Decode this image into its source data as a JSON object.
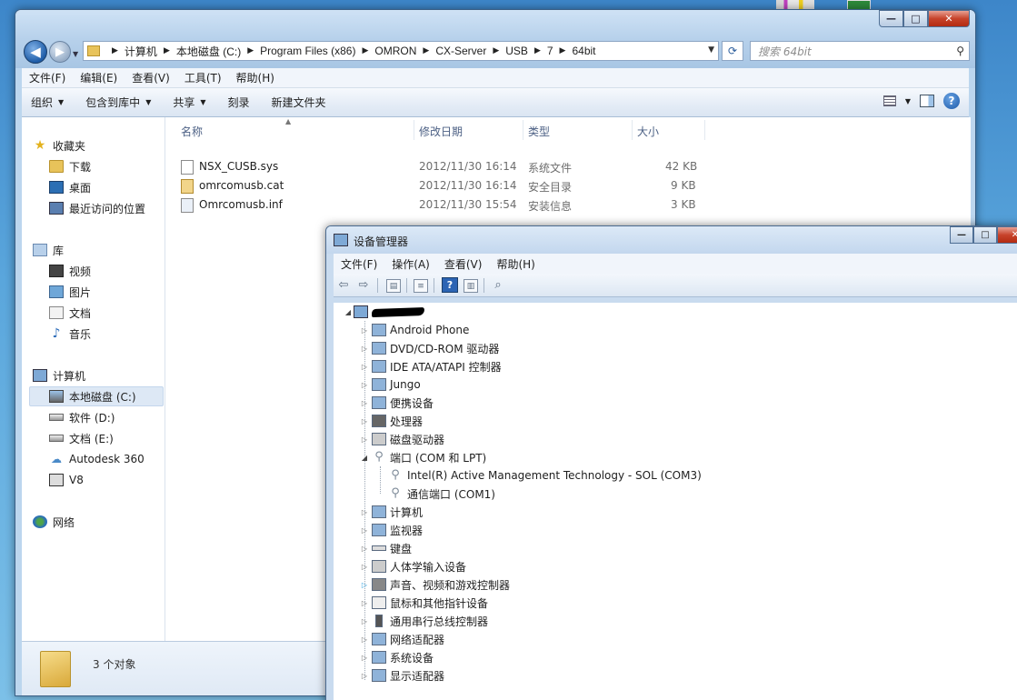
{
  "explorer": {
    "nav_buttons": {
      "back_icon": "arrow-left-icon",
      "forward_icon": "arrow-right-icon"
    },
    "breadcrumb": [
      "计算机",
      "本地磁盘 (C:)",
      "Program Files (x86)",
      "OMRON",
      "CX-Server",
      "USB",
      "7",
      "64bit"
    ],
    "search_placeholder": "搜索 64bit",
    "menu": [
      "文件(F)",
      "编辑(E)",
      "查看(V)",
      "工具(T)",
      "帮助(H)"
    ],
    "commands": [
      "组织",
      "包含到库中",
      "共享",
      "刻录",
      "新建文件夹"
    ],
    "nav": {
      "favorites": "收藏夹",
      "favorites_items": [
        "下载",
        "桌面",
        "最近访问的位置"
      ],
      "libraries": "库",
      "library_items": [
        "视频",
        "图片",
        "文档",
        "音乐"
      ],
      "computer": "计算机",
      "computer_items": [
        "本地磁盘 (C:)",
        "软件 (D:)",
        "文档 (E:)",
        "Autodesk 360",
        "V8"
      ],
      "network": "网络"
    },
    "columns": {
      "name": "名称",
      "date": "修改日期",
      "type": "类型",
      "size": "大小"
    },
    "files": [
      {
        "name": "NSX_CUSB.sys",
        "date": "2012/11/30 16:14",
        "type": "系统文件",
        "size": "42 KB",
        "icon": "sys-file-icon"
      },
      {
        "name": "omrcomusb.cat",
        "date": "2012/11/30 16:14",
        "type": "安全目录",
        "size": "9 KB",
        "icon": "cat-file-icon"
      },
      {
        "name": "Omrcomusb.inf",
        "date": "2012/11/30 15:54",
        "type": "安装信息",
        "size": "3 KB",
        "icon": "inf-file-icon"
      }
    ],
    "status": "3 个对象"
  },
  "devmgr": {
    "title": "设备管理器",
    "menu": [
      "文件(F)",
      "操作(A)",
      "查看(V)",
      "帮助(H)"
    ],
    "toolbar_icons": [
      "back-icon",
      "forward-icon",
      "show-hide-console-tree-icon",
      "properties-icon",
      "help-icon",
      "action-pane-icon",
      "scan-hardware-icon"
    ],
    "tree": {
      "categories": [
        "Android Phone",
        "DVD/CD-ROM 驱动器",
        "IDE ATA/ATAPI 控制器",
        "Jungo",
        "便携设备",
        "处理器",
        "磁盘驱动器",
        "端口 (COM 和 LPT)",
        "计算机",
        "监视器",
        "键盘",
        "人体学输入设备",
        "声音、视频和游戏控制器",
        "鼠标和其他指针设备",
        "通用串行总线控制器",
        "网络适配器",
        "系统设备",
        "显示适配器"
      ],
      "port_children": [
        "Intel(R) Active Management Technology - SOL (COM3)",
        "通信端口 (COM1)"
      ]
    }
  }
}
